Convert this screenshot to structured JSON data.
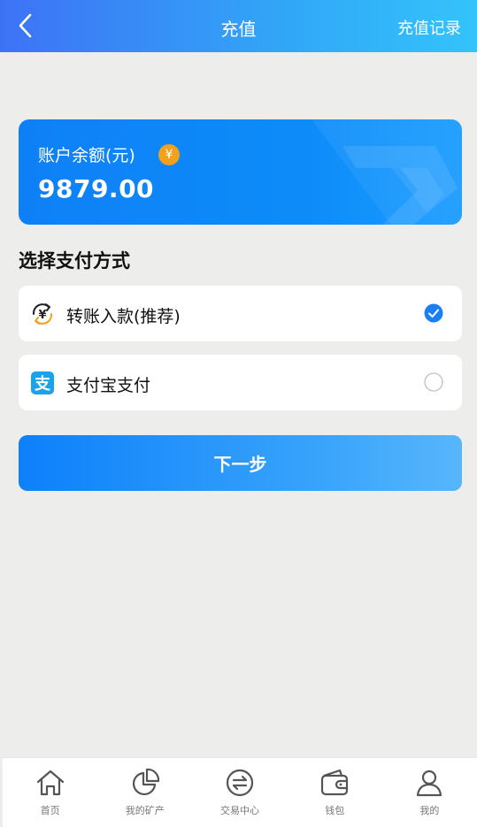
{
  "header": {
    "title": "充值",
    "right_link": "充值记录"
  },
  "balance": {
    "label": "账户余额(元)",
    "currency_symbol": "¥",
    "value": "9879.00"
  },
  "payment": {
    "section_title": "选择支付方式",
    "options": [
      {
        "label": "转账入款(推荐)",
        "icon": "yuan-transfer-icon",
        "selected": true
      },
      {
        "label": "支付宝支付",
        "icon": "alipay-icon",
        "selected": false
      }
    ]
  },
  "actions": {
    "next_label": "下一步"
  },
  "tabbar": {
    "items": [
      {
        "label": "首页",
        "icon": "home-icon"
      },
      {
        "label": "我的矿产",
        "icon": "pie-chart-icon"
      },
      {
        "label": "交易中心",
        "icon": "exchange-icon"
      },
      {
        "label": "钱包",
        "icon": "wallet-icon"
      },
      {
        "label": "我的",
        "icon": "user-icon"
      }
    ]
  },
  "colors": {
    "header_gradient_start": "#3e72f6",
    "header_gradient_end": "#34c3fb",
    "card_blue": "#0e80f7",
    "accent": "#1a7ff5",
    "coin": "#f1a11c",
    "alipay": "#1aa3e8"
  }
}
